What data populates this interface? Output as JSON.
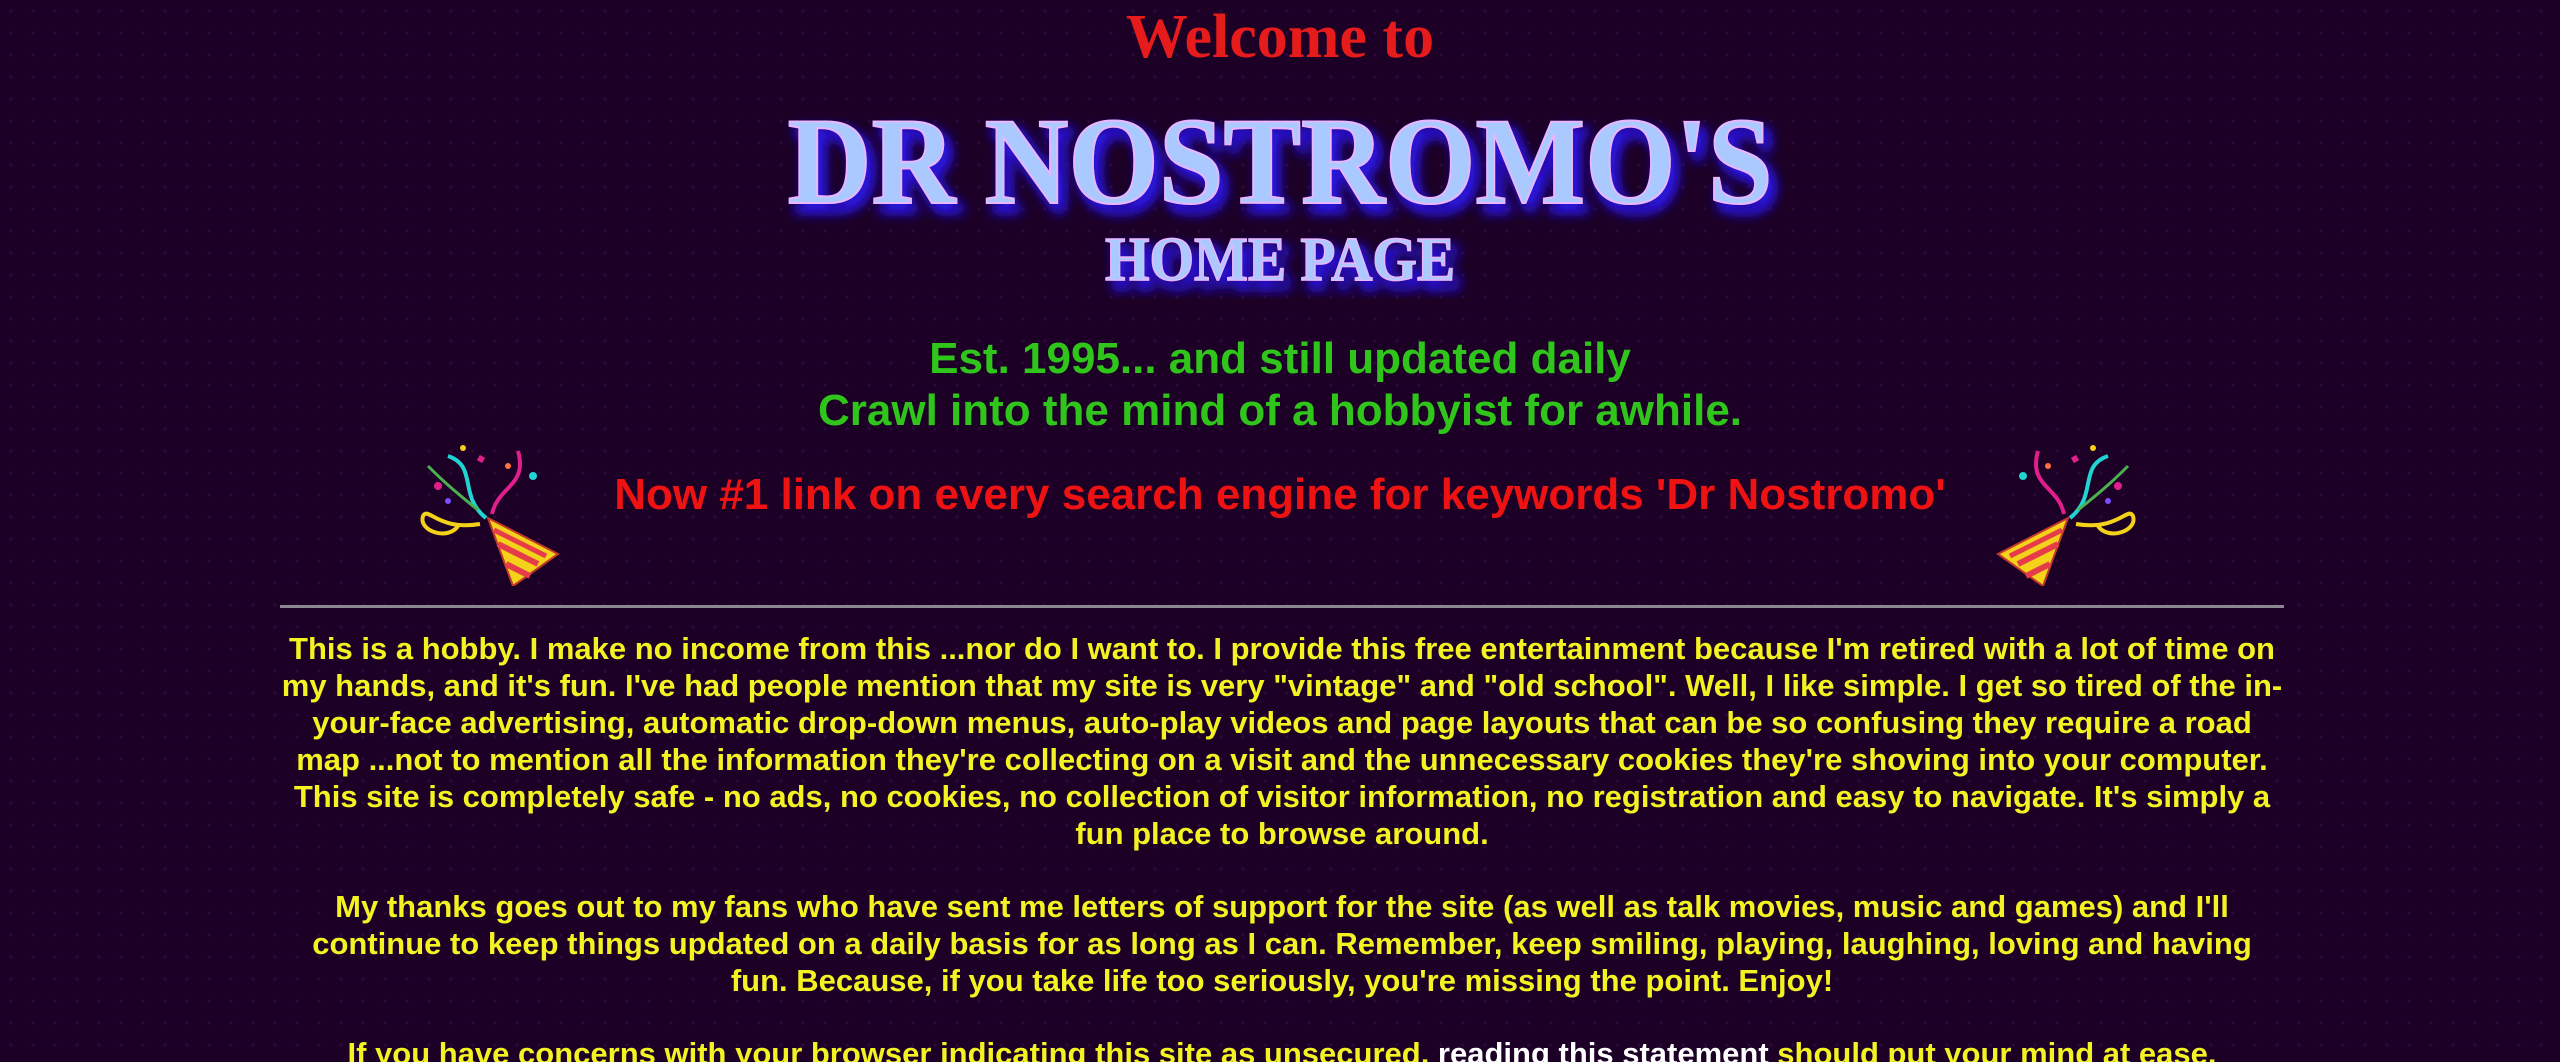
{
  "header": {
    "welcome": "Welcome to",
    "logo_line1": "DR NOSTROMO'S",
    "logo_line2": "HOME PAGE"
  },
  "tagline": {
    "line1": "Est. 1995... and still updated daily",
    "line2": "Crawl into the mind of a hobbyist for awhile."
  },
  "banner": {
    "text": "Now #1 link on every search engine for keywords 'Dr Nostromo'",
    "icons": [
      "party-popper-icon",
      "party-popper-icon"
    ]
  },
  "body": {
    "para1": "This is a hobby. I make no income from this ...nor do I want to. I provide this free entertainment because I'm retired with a lot of time on my hands, and it's fun. I've had people mention that my site is very \"vintage\" and \"old school\". Well, I like simple. I get so tired of the in-your-face advertising, automatic drop-down menus, auto-play videos and page layouts that can be so confusing they require a road map ...not to mention all the information they're collecting on a visit and the unnecessary cookies they're shoving into your computer. This site is completely safe - no ads, no cookies, no collection of visitor information, no registration and easy to navigate. It's simply a fun place to browse around.",
    "para2": "My thanks goes out to my fans who have sent me letters of support for the site (as well as talk movies, music and games) and I'll continue to keep things updated on a daily basis for as long as I can. Remember, keep smiling, playing, laughing, loving and having fun. Because, if you take life too seriously, you're missing the point. Enjoy!",
    "para3_before": "If you have concerns with your browser indicating this site as unsecured, ",
    "para3_link": "reading this statement",
    "para3_after": " should put your mind at ease."
  },
  "colors": {
    "background": "#1c0026",
    "welcome": "#e61b1b",
    "logo_fill": "#a9c9ff",
    "logo_glow": "#2b18d9",
    "tagline": "#2fc51b",
    "banner": "#ee1212",
    "body_text": "#f3f222",
    "link": "#ffffff",
    "divider": "#8d8794"
  }
}
